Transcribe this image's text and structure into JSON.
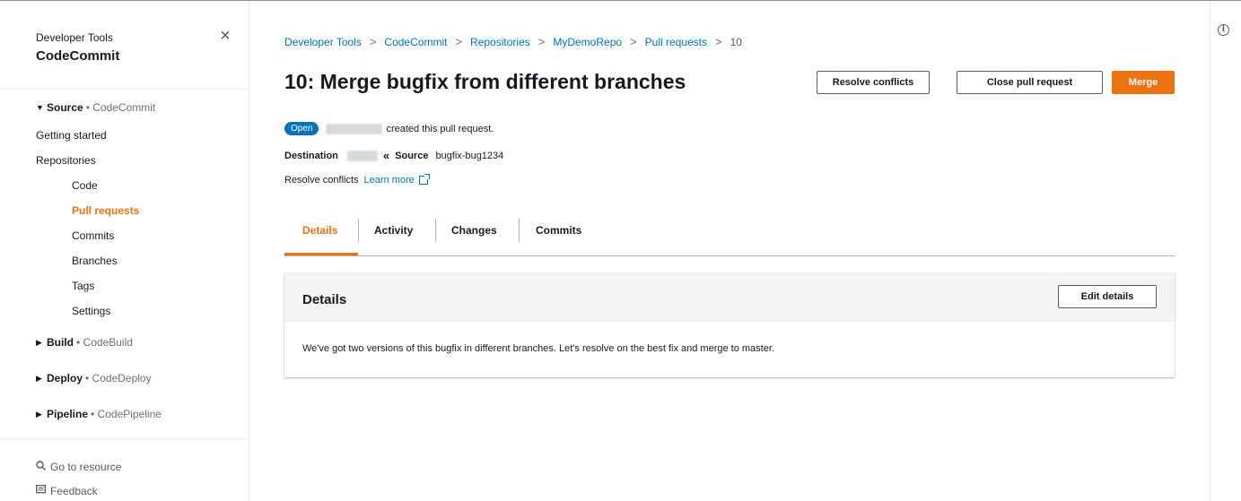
{
  "sidebar": {
    "service_group": "Developer Tools",
    "service_name": "CodeCommit",
    "close_glyph": "×",
    "source": {
      "caret": "▼",
      "label": "Source",
      "service": "• CodeCommit"
    },
    "getting_started": "Getting started",
    "repositories": "Repositories",
    "code": "Code",
    "pull_requests": "Pull requests",
    "commits": "Commits",
    "branches": "Branches",
    "tags": "Tags",
    "settings": "Settings",
    "build": {
      "caret": "▶",
      "label": "Build",
      "service": "• CodeBuild"
    },
    "deploy": {
      "caret": "▶",
      "label": "Deploy",
      "service": "• CodeDeploy"
    },
    "pipeline": {
      "caret": "▶",
      "label": "Pipeline",
      "service": "• CodePipeline"
    },
    "go_to_resource": "Go to resource",
    "feedback": "Feedback"
  },
  "breadcrumb": {
    "items": [
      "Developer Tools",
      "CodeCommit",
      "Repositories",
      "MyDemoRepo",
      "Pull requests",
      "10"
    ],
    "separator": ">"
  },
  "title": "10: Merge bugfix from different branches",
  "buttons": {
    "resolve_conflicts": "Resolve conflicts",
    "close_pull_request": "Close pull request",
    "merge": "Merge"
  },
  "status": {
    "badge": "Open",
    "created_text": "created this pull request."
  },
  "branches": {
    "destination_label": "Destination",
    "arrow": "«",
    "source_label": "Source",
    "source_branch": "bugfix-bug1234"
  },
  "resolve": {
    "text": "Resolve conflicts",
    "learn_more": "Learn more"
  },
  "tabs": [
    "Details",
    "Activity",
    "Changes",
    "Commits"
  ],
  "details": {
    "title": "Details",
    "edit_button": "Edit details",
    "description": "We've got two versions of this bugfix in different branches. Let's resolve on the best fix and merge to master."
  },
  "info_glyph": "i",
  "colors": {
    "accent": "#ec7211",
    "link": "#0073bb",
    "badge": "#0073bb"
  }
}
